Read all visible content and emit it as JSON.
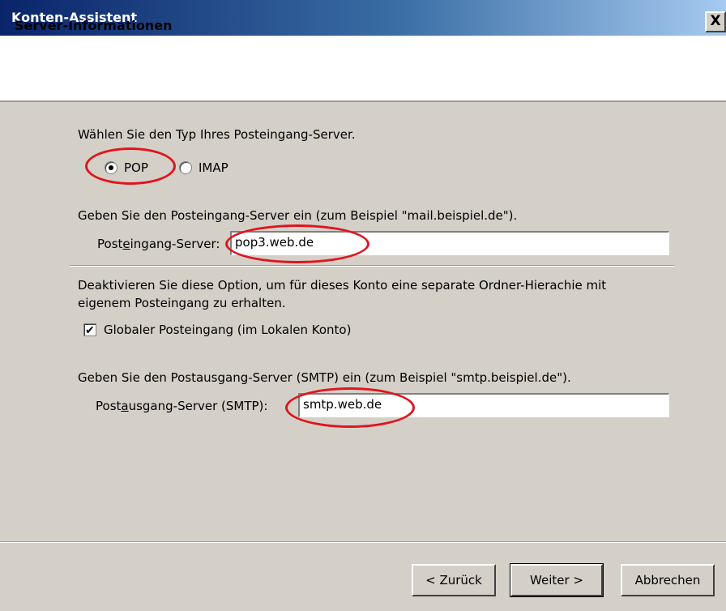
{
  "window": {
    "title": "Konten-Assistent",
    "close_glyph": "X"
  },
  "header": {
    "title": "Server-Informationen"
  },
  "server_type": {
    "prompt": "Wählen Sie den Typ Ihres Posteingang-Server.",
    "options": [
      {
        "label": "POP",
        "selected": true
      },
      {
        "label": "IMAP",
        "selected": false
      }
    ]
  },
  "incoming": {
    "prompt": "Geben Sie den Posteingang-Server ein (zum Beispiel \"mail.beispiel.de\").",
    "label_pre": "Post",
    "label_access": "e",
    "label_post": "ingang-Server:",
    "value": "pop3.web.de"
  },
  "global_inbox": {
    "prompt_line1": "Deaktivieren Sie diese Option, um für dieses Konto eine separate Ordner-Hierachie mit",
    "prompt_line2": "eigenem Posteingang zu erhalten.",
    "label": "Globaler Posteingang (im Lokalen Konto)",
    "checked": true,
    "check_glyph": "✔"
  },
  "outgoing": {
    "prompt": "Geben Sie den Postausgang-Server (SMTP) ein (zum Beispiel \"smtp.beispiel.de\").",
    "label_pre": "Post",
    "label_access": "a",
    "label_post": "usgang-Server (SMTP):",
    "value": "smtp.web.de"
  },
  "buttons": {
    "back": "< Zurück",
    "next": "Weiter >",
    "cancel": "Abbrechen"
  },
  "colors": {
    "annotation": "#e0141e",
    "dialog_bg": "#d4d0c8"
  }
}
